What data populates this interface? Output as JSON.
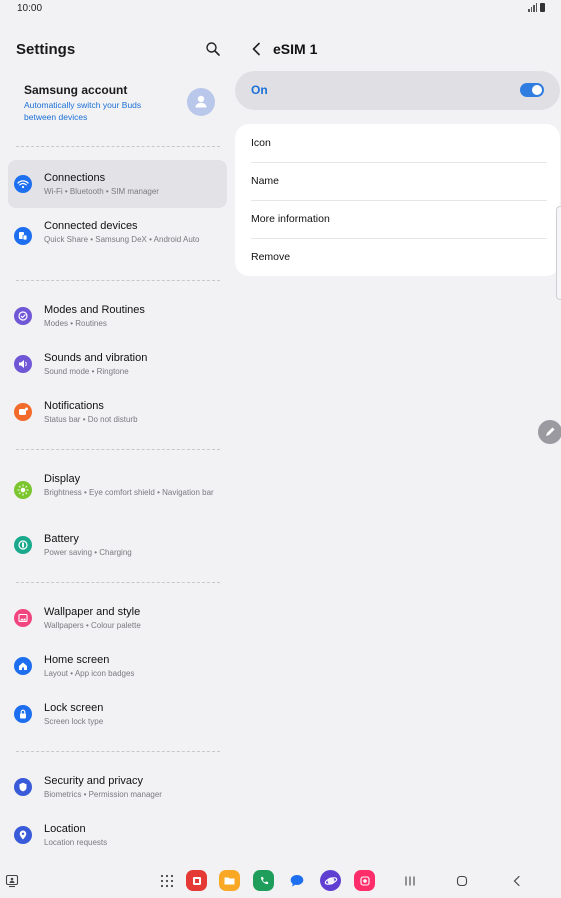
{
  "status_bar": {
    "time": "10:00"
  },
  "left_pane": {
    "title": "Settings",
    "account": {
      "name": "Samsung account",
      "subtitle": "Automatically switch your Buds between devices"
    },
    "items": [
      {
        "title": "Connections",
        "subtitle": "Wi-Fi  •  Bluetooth  •  SIM manager",
        "icon": "wifi-icon",
        "color": "#1e6ff0"
      },
      {
        "title": "Connected devices",
        "subtitle": "Quick Share  •  Samsung DeX  •  Android Auto",
        "icon": "devices-icon",
        "color": "#1e6ff0"
      },
      {
        "title": "Modes and Routines",
        "subtitle": "Modes  •  Routines",
        "icon": "check-circle-icon",
        "color": "#7057d6"
      },
      {
        "title": "Sounds and vibration",
        "subtitle": "Sound mode  •  Ringtone",
        "icon": "speaker-icon",
        "color": "#7057d6"
      },
      {
        "title": "Notifications",
        "subtitle": "Status bar  •  Do not disturb",
        "icon": "bell-icon",
        "color": "#f26b2a"
      },
      {
        "title": "Display",
        "subtitle": "Brightness  •  Eye comfort shield  •  Navigation bar",
        "icon": "sun-icon",
        "color": "#7bc62e"
      },
      {
        "title": "Battery",
        "subtitle": "Power saving  •  Charging",
        "icon": "battery-icon",
        "color": "#1aa98c"
      },
      {
        "title": "Wallpaper and style",
        "subtitle": "Wallpapers  •  Colour palette",
        "icon": "image-icon",
        "color": "#f2457f"
      },
      {
        "title": "Home screen",
        "subtitle": "Layout  •  App icon badges",
        "icon": "home-icon",
        "color": "#1e6ff0"
      },
      {
        "title": "Lock screen",
        "subtitle": "Screen lock type",
        "icon": "lock-icon",
        "color": "#1e6ff0"
      },
      {
        "title": "Security and privacy",
        "subtitle": "Biometrics  •  Permission manager",
        "icon": "shield-icon",
        "color": "#3a5bd9"
      },
      {
        "title": "Location",
        "subtitle": "Location requests",
        "icon": "location-pin-icon",
        "color": "#3a5bd9"
      }
    ]
  },
  "right_pane": {
    "title": "eSIM 1",
    "toggle": {
      "label": "On",
      "state": "on"
    },
    "options": [
      "Icon",
      "Name",
      "More information",
      "Remove"
    ]
  },
  "navbar": {
    "apps": [
      "app-drawer-icon",
      "flipboard-icon",
      "my-files-icon",
      "phone-icon",
      "messages-icon",
      "internet-icon",
      "screen-recorder-icon"
    ],
    "buttons": [
      "recents-button",
      "home-button",
      "back-button"
    ]
  },
  "colors": {
    "accent": "#1a6fd6",
    "background": "#f2f2f4",
    "card": "#ffffff"
  }
}
